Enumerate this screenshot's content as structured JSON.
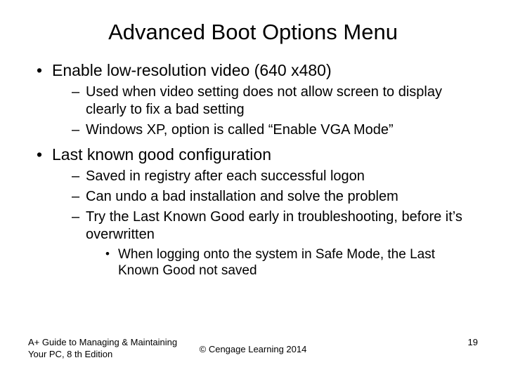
{
  "title": "Advanced Boot Options Menu",
  "bullets": [
    {
      "text": "Enable low-resolution video (640 x480)",
      "sub": [
        {
          "text": "Used when video setting does not allow screen to display clearly to fix a bad setting"
        },
        {
          "text": "Windows XP, option is called “Enable VGA Mode”"
        }
      ]
    },
    {
      "text": "Last known good configuration",
      "sub": [
        {
          "text": "Saved in registry after each successful logon"
        },
        {
          "text": "Can undo a bad installation and solve the problem"
        },
        {
          "text": "Try the Last Known Good early in troubleshooting, before it’s overwritten",
          "sub": [
            {
              "text": "When logging onto the system in Safe Mode, the Last Known Good not saved"
            }
          ]
        }
      ]
    }
  ],
  "footer": {
    "left": "A+ Guide to Managing & Maintaining Your PC, 8 th Edition",
    "center": "© Cengage Learning  2014",
    "page": "19"
  }
}
